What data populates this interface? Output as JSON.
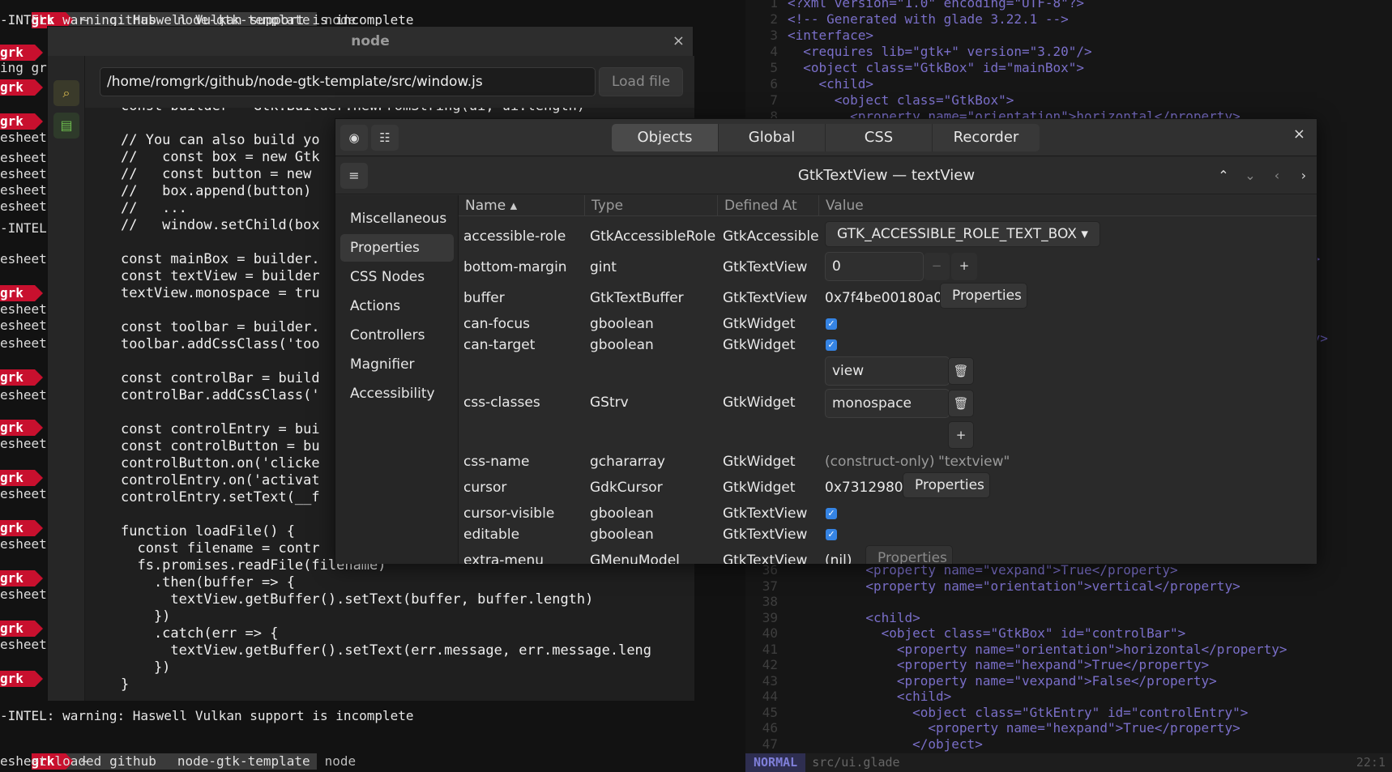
{
  "terminal": {
    "prompt_user": "grk",
    "path_segments": [
      "~",
      "github",
      "node-gtk-template"
    ],
    "command": "node",
    "warning_text": "-INTEL: warning: Haswell Vulkan support is incomplete",
    "fragment_lines": [
      "ing gr",
      "esheet",
      "-INTEL",
      "esheet loaded",
      "esheet loaded"
    ]
  },
  "editor": {
    "visible_lines": [
      {
        "num": "1",
        "code": "<?xml version=\"1.0\" encoding=\"UTF-8\"?>"
      },
      {
        "num": "2",
        "code": "<!-- Generated with glade 3.22.1 -->"
      },
      {
        "num": "3",
        "code": "<interface>"
      },
      {
        "num": "4",
        "code": "  <requires lib=\"gtk+\" version=\"3.20\"/>"
      },
      {
        "num": "5",
        "code": "  <object class=\"GtkBox\" id=\"mainBox\">"
      },
      {
        "num": "6",
        "code": "    <child>"
      },
      {
        "num": "7",
        "code": "      <object class=\"GtkBox\">"
      },
      {
        "num": "8",
        "code": "        <property name=\"orientation\">horizontal</property>"
      }
    ],
    "lower_lines": [
      {
        "num": "36",
        "code": "          <property name=\"vexpand\">True</property>"
      },
      {
        "num": "37",
        "code": "          <property name=\"orientation\">vertical</property>"
      },
      {
        "num": "38",
        "code": ""
      },
      {
        "num": "39",
        "code": "          <child>"
      },
      {
        "num": "40",
        "code": "            <object class=\"GtkBox\" id=\"controlBar\">"
      },
      {
        "num": "41",
        "code": "              <property name=\"orientation\">horizontal</property>"
      },
      {
        "num": "42",
        "code": "              <property name=\"hexpand\">True</property>"
      },
      {
        "num": "43",
        "code": "              <property name=\"vexpand\">False</property>"
      },
      {
        "num": "44",
        "code": "              <child>"
      },
      {
        "num": "45",
        "code": "                <object class=\"GtkEntry\" id=\"controlEntry\">"
      },
      {
        "num": "46",
        "code": "                  <property name=\"hexpand\">True</property>"
      },
      {
        "num": "47",
        "code": "                </object>"
      }
    ],
    "side_fragments": [
      "y>",
      "ty>"
    ],
    "status_mode": "NORMAL",
    "status_file": "src/ui.glade",
    "status_pos": "22:1"
  },
  "node_window": {
    "title": "node",
    "close": "×",
    "entry_value": "/home/romgrk/github/node-gtk-template/src/window.js",
    "load_button": "Load file",
    "code_lines": [
      "const builder = Gtk.Builder.newFromString(ui, ui.length)",
      "",
      "// You can also build yo",
      "//   const box = new Gtk",
      "//   const button = new ",
      "//   box.append(button)",
      "//   ...",
      "//   window.setChild(box",
      "",
      "const mainBox = builder.",
      "const textView = builder",
      "textView.monospace = tru",
      "",
      "const toolbar = builder.",
      "toolbar.addCssClass('too",
      "",
      "const controlBar = build",
      "controlBar.addCssClass('",
      "",
      "const controlEntry = bui",
      "const controlButton = bu",
      "controlButton.on('clicke",
      "controlEntry.on('activat",
      "controlEntry.setText(__f",
      "",
      "function loadFile() {",
      "  const filename = contr",
      "  fs.promises.readFile(filename)",
      "    .then(buffer => {",
      "      textView.getBuffer().setText(buffer, buffer.length)",
      "    })",
      "    .catch(err => {",
      "      textView.getBuffer().setText(err.message, err.message.leng",
      "    })",
      "}"
    ]
  },
  "inspector": {
    "tabs": [
      "Objects",
      "Global",
      "CSS",
      "Recorder"
    ],
    "active_tab": "Objects",
    "close": "×",
    "object_title": "GtkTextView — textView",
    "nav_items": [
      "Miscellaneous",
      "Properties",
      "CSS Nodes",
      "Actions",
      "Controllers",
      "Magnifier",
      "Accessibility"
    ],
    "active_nav": "Properties",
    "columns": {
      "name": "Name",
      "type": "Type",
      "defined_at": "Defined At",
      "value": "Value"
    },
    "rows": [
      {
        "name": "accessible-role",
        "type": "GtkAccessibleRole",
        "defined": "GtkAccessible",
        "value": "GTK_ACCESSIBLE_ROLE_TEXT_BOX"
      },
      {
        "name": "bottom-margin",
        "type": "gint",
        "defined": "GtkTextView",
        "value": "0"
      },
      {
        "name": "buffer",
        "type": "GtkTextBuffer",
        "defined": "GtkTextView",
        "value": "0x7f4be00180a0",
        "button": "Properties"
      },
      {
        "name": "can-focus",
        "type": "gboolean",
        "defined": "GtkWidget"
      },
      {
        "name": "can-target",
        "type": "gboolean",
        "defined": "GtkWidget"
      },
      {
        "name": "css-classes",
        "type": "GStrv",
        "defined": "GtkWidget",
        "values": [
          "view",
          "monospace"
        ]
      },
      {
        "name": "css-name",
        "type": "gchararray",
        "defined": "GtkWidget",
        "note": "(construct-only)",
        "value": "\"textview\""
      },
      {
        "name": "cursor",
        "type": "GdkCursor",
        "defined": "GtkWidget",
        "value": "0x7312980",
        "button": "Properties"
      },
      {
        "name": "cursor-visible",
        "type": "gboolean",
        "defined": "GtkTextView"
      },
      {
        "name": "editable",
        "type": "gboolean",
        "defined": "GtkTextView"
      },
      {
        "name": "extra-menu",
        "type": "GMenuModel",
        "defined": "GtkTextView",
        "value": "(nil)",
        "button": "Properties"
      }
    ],
    "stepper_minus": "−",
    "stepper_plus": "+",
    "add_class": "+"
  }
}
